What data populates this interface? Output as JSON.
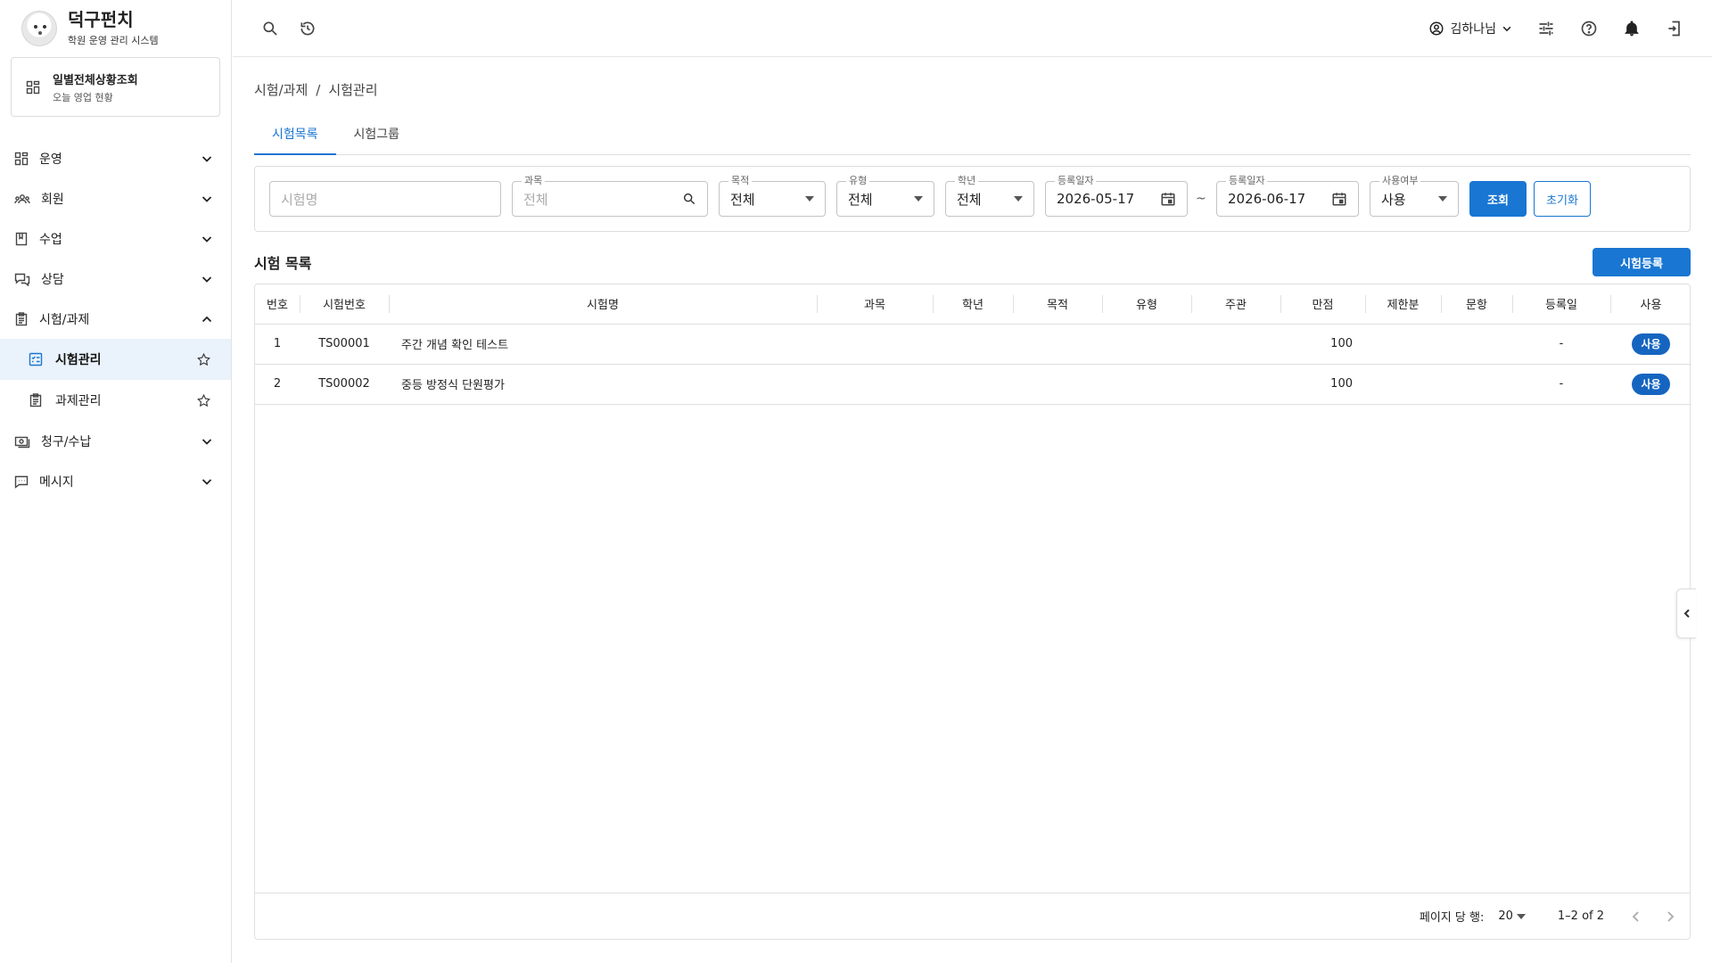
{
  "brand": {
    "name": "덕구펀치",
    "subtitle": "학원 운영 관리 시스템"
  },
  "dashboard_card": {
    "title": "일별전체상황조회",
    "subtitle": "오늘 영업 현황"
  },
  "nav": {
    "items": [
      {
        "label": "운영"
      },
      {
        "label": "회원"
      },
      {
        "label": "수업"
      },
      {
        "label": "상담"
      },
      {
        "label": "시험/과제"
      },
      {
        "label": "청구/수납"
      },
      {
        "label": "메시지"
      }
    ],
    "sub_items": [
      {
        "label": "시험관리"
      },
      {
        "label": "과제관리"
      }
    ]
  },
  "header": {
    "user_name": "김하나님"
  },
  "breadcrumb": {
    "parent": "시험/과제",
    "separator": "/",
    "current": "시험관리"
  },
  "tabs": [
    {
      "label": "시험목록"
    },
    {
      "label": "시험그룹"
    }
  ],
  "filters": {
    "exam_name_placeholder": "시험명",
    "subject": {
      "label": "과목",
      "placeholder": "전체"
    },
    "purpose": {
      "label": "목적",
      "value": "전체"
    },
    "type": {
      "label": "유형",
      "value": "전체"
    },
    "grade": {
      "label": "학년",
      "value": "전체"
    },
    "date_from": {
      "label": "등록일자",
      "value": "2026-05-17"
    },
    "date_sep": "~",
    "date_to": {
      "label": "등록일자",
      "value": "2026-06-17"
    },
    "use_status": {
      "label": "사용여부",
      "value": "사용"
    },
    "search_label": "조회",
    "reset_label": "초기화"
  },
  "list": {
    "title": "시험 목록",
    "add_label": "시험등록",
    "columns": [
      "번호",
      "시험번호",
      "시험명",
      "과목",
      "학년",
      "목적",
      "유형",
      "주관",
      "만점",
      "제한분",
      "문항",
      "등록일",
      "사용"
    ],
    "rows": [
      {
        "no": "1",
        "code": "TS00001",
        "name": "주간 개념 확인 테스트",
        "subject": "",
        "grade": "",
        "purpose": "",
        "type": "",
        "host": "",
        "full_score": "100",
        "time_limit": "",
        "questions": "",
        "reg_date": "-",
        "use": "사용"
      },
      {
        "no": "2",
        "code": "TS00002",
        "name": "중등 방정식 단원평가",
        "subject": "",
        "grade": "",
        "purpose": "",
        "type": "",
        "host": "",
        "full_score": "100",
        "time_limit": "",
        "questions": "",
        "reg_date": "-",
        "use": "사용"
      }
    ]
  },
  "pager": {
    "rows_per_page_label": "페이지 당 행:",
    "rows_per_page": "20",
    "range": "1–2 of 2"
  },
  "colors": {
    "accent": "#1976d2",
    "badge": "#1565c0",
    "active_nav_bg": "#eaf2fb"
  }
}
